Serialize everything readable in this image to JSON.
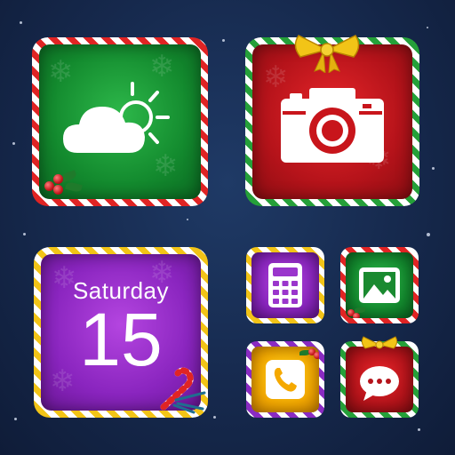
{
  "home_screen": {
    "widgets": {
      "weather": {
        "icon": "weather-partly-cloudy-icon",
        "accent": "#138a2e",
        "border": "#e02424"
      },
      "camera": {
        "icon": "camera-icon",
        "accent": "#b5131a",
        "border": "#25a039"
      },
      "calendar": {
        "day_name": "Saturday",
        "day_number": "15",
        "accent": "#8a25bf",
        "border": "#f2c417"
      }
    },
    "apps": [
      {
        "name": "calculator",
        "icon": "calculator-icon",
        "accent": "#8a25bf",
        "border": "#f2c417"
      },
      {
        "name": "gallery",
        "icon": "image-icon",
        "accent": "#138a2e",
        "border": "#e02424"
      },
      {
        "name": "phone",
        "icon": "phone-icon",
        "accent": "#f5a900",
        "border": "#8a2bc2"
      },
      {
        "name": "messages",
        "icon": "message-bubble-icon",
        "accent": "#b5131a",
        "border": "#25a039"
      }
    ],
    "decorations": [
      "holly-berries-icon",
      "gold-bow-icon",
      "candy-cane-icon",
      "snowflake-icon"
    ]
  }
}
